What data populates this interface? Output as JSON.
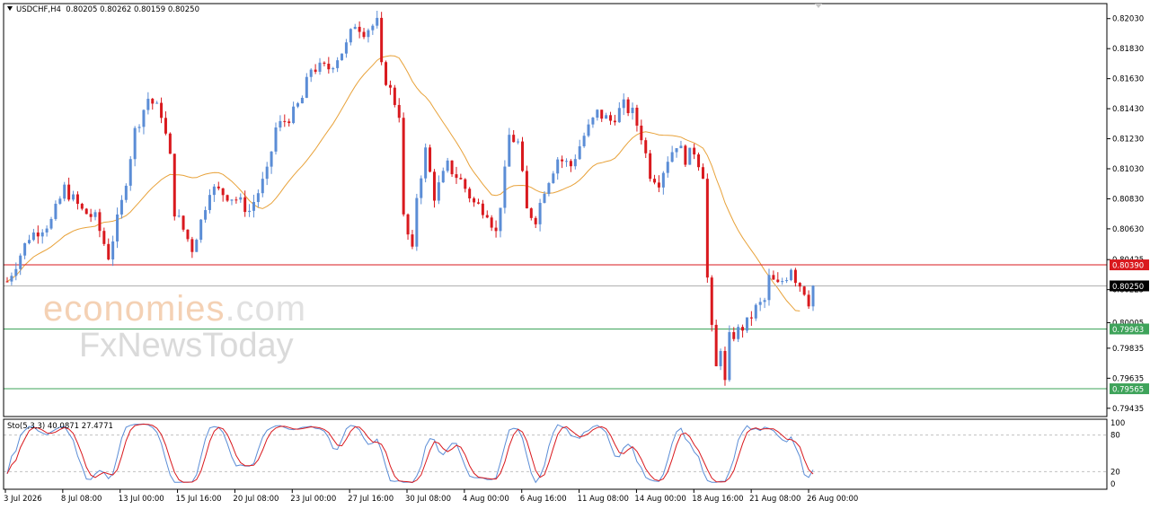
{
  "header": {
    "symbol": "USDCHF,H4",
    "ohlc": "0.80205 0.80262 0.80159 0.80250"
  },
  "watermark": {
    "brand_main": "economies",
    "brand_suffix": ".com",
    "brand_second": "FxNewsToday"
  },
  "indicator": {
    "label": "Sto(5,3,3) 40.0871 27.4771",
    "levels": [
      100,
      80,
      20,
      0
    ]
  },
  "colors": {
    "bull": "#5b8dd6",
    "bear": "#d9191e",
    "ma": "#e8a23a",
    "resistance": "#d9191e",
    "support": "#3ea35a",
    "stoch_main": "#5b8dd6",
    "stoch_signal": "#d9191e"
  },
  "chart_data": {
    "type": "candlestick",
    "y_range": [
      0.7938,
      0.8213
    ],
    "price_ticks": [
      "0.82030",
      "0.81830",
      "0.81630",
      "0.81430",
      "0.81230",
      "0.81030",
      "0.80830",
      "0.80630",
      "0.80425",
      "0.80225",
      "0.80005",
      "0.79835",
      "0.79635",
      "0.79435"
    ],
    "time_labels": [
      "3 Jul 2026",
      "8 Jul 08:00",
      "13 Jul 00:00",
      "15 Jul 16:00",
      "20 Jul 08:00",
      "23 Jul 00:00",
      "27 Jul 16:00",
      "30 Jul 08:00",
      "4 Aug 00:00",
      "6 Aug 16:00",
      "11 Aug 08:00",
      "14 Aug 00:00",
      "18 Aug 16:00",
      "21 Aug 08:00",
      "26 Aug 00:00"
    ],
    "horizontal_lines": [
      {
        "price": 0.8039,
        "label": "0.80390",
        "kind": "resistance"
      },
      {
        "price": 0.8025,
        "label": "0.80250",
        "kind": "current"
      },
      {
        "price": 0.79963,
        "label": "0.79963",
        "kind": "support"
      },
      {
        "price": 0.79565,
        "label": "0.79565",
        "kind": "support"
      }
    ],
    "close_path": [
      [
        0,
        0.8028
      ],
      [
        5,
        0.8058
      ],
      [
        10,
        0.8068
      ],
      [
        13,
        0.809
      ],
      [
        17,
        0.8075
      ],
      [
        20,
        0.807
      ],
      [
        23,
        0.8045
      ],
      [
        26,
        0.808
      ],
      [
        29,
        0.8128
      ],
      [
        32,
        0.815
      ],
      [
        35,
        0.814
      ],
      [
        37,
        0.811
      ],
      [
        38,
        0.8075
      ],
      [
        42,
        0.805
      ],
      [
        44,
        0.8068
      ],
      [
        46,
        0.809
      ],
      [
        48,
        0.8088
      ],
      [
        52,
        0.8083
      ],
      [
        55,
        0.8075
      ],
      [
        59,
        0.81
      ],
      [
        61,
        0.813
      ],
      [
        65,
        0.814
      ],
      [
        67,
        0.815
      ],
      [
        69,
        0.817
      ],
      [
        73,
        0.817
      ],
      [
        77,
        0.8185
      ],
      [
        79,
        0.82
      ],
      [
        81,
        0.8195
      ],
      [
        84,
        0.82
      ],
      [
        85,
        0.817
      ],
      [
        87,
        0.8155
      ],
      [
        89,
        0.814
      ],
      [
        90,
        0.807
      ],
      [
        92,
        0.8047
      ],
      [
        93,
        0.8085
      ],
      [
        95,
        0.8115
      ],
      [
        97,
        0.8085
      ],
      [
        100,
        0.8105
      ],
      [
        103,
        0.8095
      ],
      [
        106,
        0.808
      ],
      [
        109,
        0.8075
      ],
      [
        111,
        0.806
      ],
      [
        113,
        0.81
      ],
      [
        114,
        0.8125
      ],
      [
        116,
        0.812
      ],
      [
        118,
        0.8075
      ],
      [
        120,
        0.807
      ],
      [
        122,
        0.809
      ],
      [
        125,
        0.811
      ],
      [
        128,
        0.8105
      ],
      [
        131,
        0.8125
      ],
      [
        134,
        0.814
      ],
      [
        137,
        0.8135
      ],
      [
        140,
        0.8145
      ],
      [
        142,
        0.814
      ],
      [
        144,
        0.8125
      ],
      [
        146,
        0.81
      ],
      [
        148,
        0.8095
      ],
      [
        150,
        0.811
      ],
      [
        152,
        0.812
      ],
      [
        154,
        0.811
      ],
      [
        156,
        0.8115
      ],
      [
        158,
        0.81
      ],
      [
        159,
        0.803
      ],
      [
        160,
        0.7995
      ],
      [
        161,
        0.797
      ],
      [
        162,
        0.7985
      ],
      [
        163,
        0.796
      ],
      [
        164,
        0.799
      ],
      [
        166,
        0.7995
      ],
      [
        168,
        0.8
      ],
      [
        170,
        0.801
      ],
      [
        172,
        0.8015
      ],
      [
        173,
        0.803
      ],
      [
        175,
        0.8025
      ],
      [
        177,
        0.8032
      ],
      [
        178,
        0.8038
      ],
      [
        179,
        0.803
      ],
      [
        181,
        0.8022
      ],
      [
        182,
        0.8015
      ],
      [
        183,
        0.8025
      ]
    ]
  }
}
